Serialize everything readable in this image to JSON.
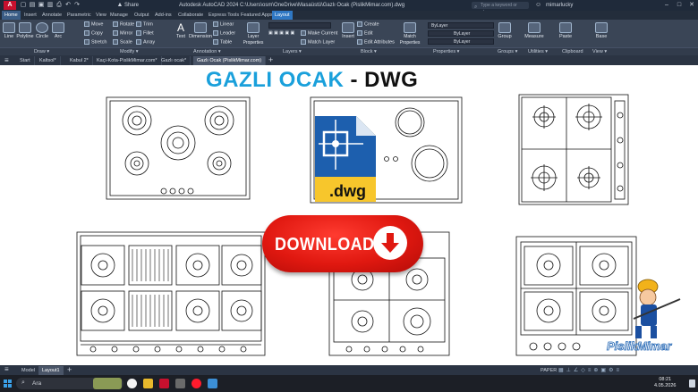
{
  "titlebar": {
    "app_logo": "A",
    "share_label": "Share",
    "title": "Autodesk AutoCAD 2024   C:\\Users\\osm\\OneDrive\\Masaüstü\\Gazlı Ocak (PislikMimar.com).dwg",
    "search_placeholder": "Type a keyword or phrase",
    "user": "mimarlucky"
  },
  "ribbon_tabs": [
    "Home",
    "Insert",
    "Annotate",
    "Parametric",
    "View",
    "Manage",
    "Output",
    "Add-ins",
    "Collaborate",
    "Express Tools",
    "Featured Apps",
    "Layout"
  ],
  "active_ribbon_tab": "Home",
  "ribbon": {
    "draw": [
      "Line",
      "Polyline",
      "Circle",
      "Arc"
    ],
    "modify": [
      "Move",
      "Rotate",
      "Trim",
      "Copy",
      "Mirror",
      "Fillet",
      "Stretch",
      "Scale",
      "Array"
    ],
    "annotation": [
      "Text",
      "Dimension",
      "Linear",
      "Leader",
      "Table"
    ],
    "layer_properties": "Layer Properties",
    "layers": [
      "Make Current",
      "Match Layer"
    ],
    "insert": "Insert",
    "block": [
      "Create",
      "Edit",
      "Edit Attributes"
    ],
    "match_properties": "Match Properties",
    "bylayer": [
      "ByLayer",
      "ByLayer",
      "ByLayer"
    ],
    "group": "Group",
    "measure": "Measure",
    "paste": "Paste",
    "base": "Base"
  },
  "panel_titles": [
    "Draw ▾",
    "Modify ▾",
    "Annotation ▾",
    "Layers ▾",
    "Block ▾",
    "Properties ▾",
    "Groups ▾",
    "Utilities ▾",
    "Clipboard",
    "View ▾"
  ],
  "doc_tabs": [
    "Start",
    "Kaltsol*",
    "Kabul 2*",
    "Kaçi-Kota-PislikMimar.com*",
    "Gazlı ocak*",
    "Gazlı Ocak (PislikMimar.com)"
  ],
  "active_doc_tab": "Gazlı Ocak (PislikMimar.com)",
  "canvas": {
    "title_part1": "GAZLI OCAK",
    "title_part2": " - DWG",
    "download_label": "DOWNLOAD",
    "dwg_label": ".dwg",
    "watermark": "PislikMimar"
  },
  "status": {
    "model_tab": "Model",
    "layout_tab": "Layout1",
    "paper": "PAPER"
  },
  "taskbar": {
    "search": "Ara",
    "time": "08:21",
    "date": "4.05.2026"
  },
  "colors": {
    "title_blue": "#1aa0db",
    "download_red": "#e01810",
    "ribbon_bg": "#3a4556",
    "active_tab": "#3b5d86"
  },
  "icons": [
    "search-icon",
    "windows-icon",
    "download-arrow-icon",
    "dwg-file-icon",
    "close-icon",
    "minimize-icon",
    "maximize-icon"
  ]
}
